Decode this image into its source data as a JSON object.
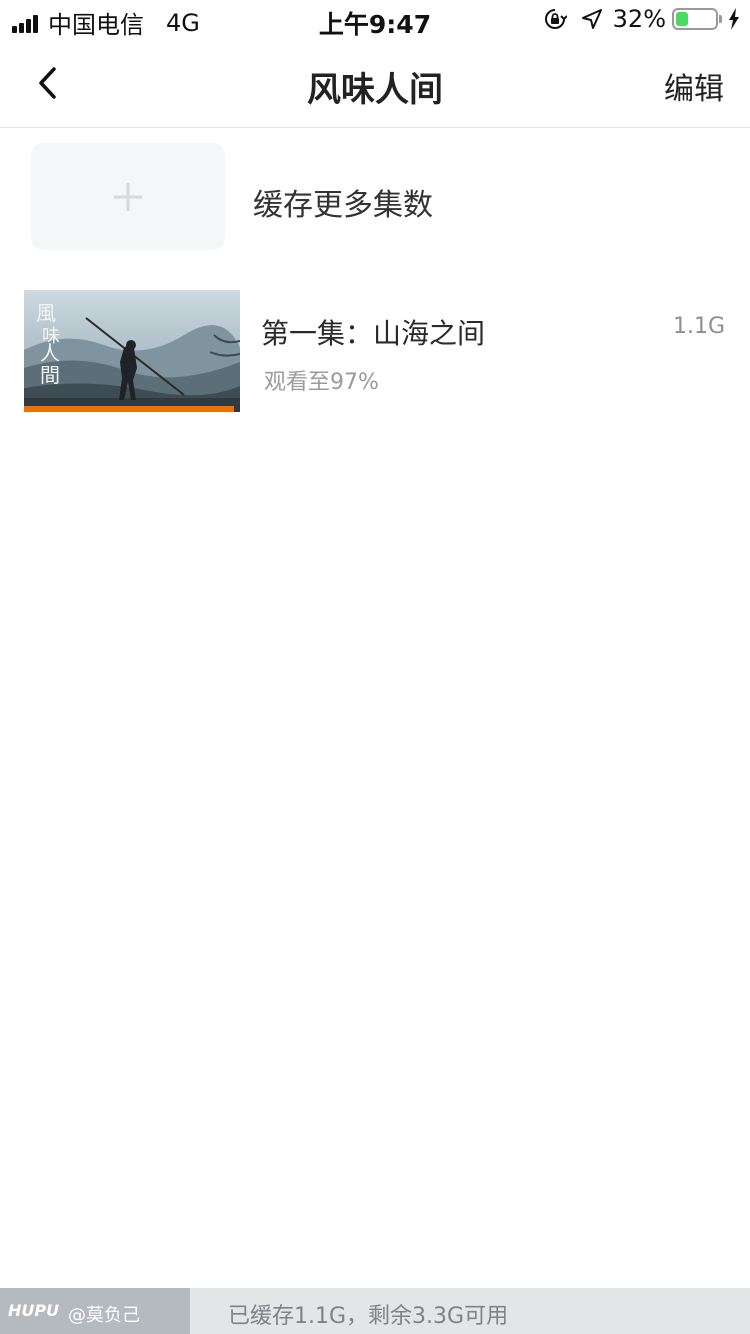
{
  "status_bar": {
    "carrier": "中国电信",
    "network": "4G",
    "time": "上午9:47",
    "battery_percent": "32%",
    "battery_level": 0.32,
    "icons": [
      "signal-icon",
      "rotation-lock-icon",
      "location-arrow-icon",
      "battery-icon",
      "charging-bolt-icon"
    ]
  },
  "nav": {
    "title": "风味人间",
    "edit_label": "编辑",
    "back_icon": "chevron-left-icon"
  },
  "cache_more": {
    "label": "缓存更多集数",
    "icon": "plus-icon"
  },
  "episodes": [
    {
      "title": "第一集：山海之间",
      "size": "1.1G",
      "progress_text": "观看至97%",
      "progress": 0.97
    }
  ],
  "storage": {
    "summary": "已缓存1.1G，剩余3.3G可用"
  },
  "watermark": {
    "logo": "HUPU",
    "user": "@莫负己"
  },
  "colors": {
    "accent_progress": "#f07100",
    "battery_green": "#4cd964",
    "storage_bar_bg": "#e3e5e7"
  }
}
